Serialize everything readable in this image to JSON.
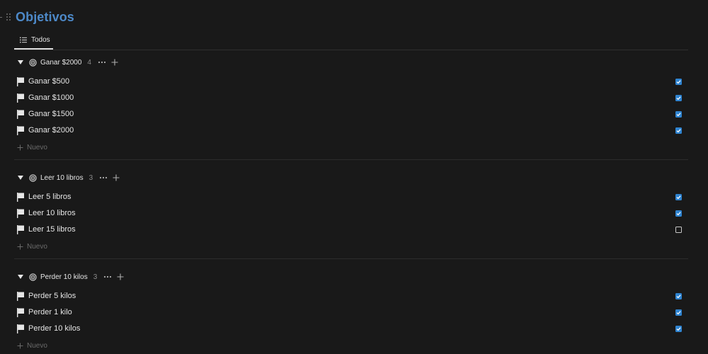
{
  "page": {
    "title": "Objetivos"
  },
  "view_tabs": [
    {
      "label": "Todos",
      "icon": "list-icon"
    }
  ],
  "groups": [
    {
      "name": "Ganar $2000",
      "count": "4",
      "icon": "target-icon",
      "items": [
        {
          "label": "Ganar $500",
          "done": true
        },
        {
          "label": "Ganar $1000",
          "done": true
        },
        {
          "label": "Ganar $1500",
          "done": true
        },
        {
          "label": "Ganar $2000",
          "done": true
        }
      ],
      "new_label": "Nuevo"
    },
    {
      "name": "Leer 10 libros",
      "count": "3",
      "icon": "target-icon",
      "items": [
        {
          "label": "Leer 5 libros",
          "done": true
        },
        {
          "label": "Leer 10 libros",
          "done": true
        },
        {
          "label": "Leer 15 libros",
          "done": false
        }
      ],
      "new_label": "Nuevo"
    },
    {
      "name": "Perder 10 kilos",
      "count": "3",
      "icon": "target-icon",
      "items": [
        {
          "label": "Perder 5 kilos",
          "done": true
        },
        {
          "label": "Perder 1 kilo",
          "done": true
        },
        {
          "label": "Perder 10 kilos",
          "done": true
        }
      ],
      "new_label": "Nuevo"
    }
  ],
  "colors": {
    "background": "#191919",
    "title": "#4d89c8",
    "checkbox_checked": "#2f84d1",
    "muted_text": "#6a6a6a"
  }
}
